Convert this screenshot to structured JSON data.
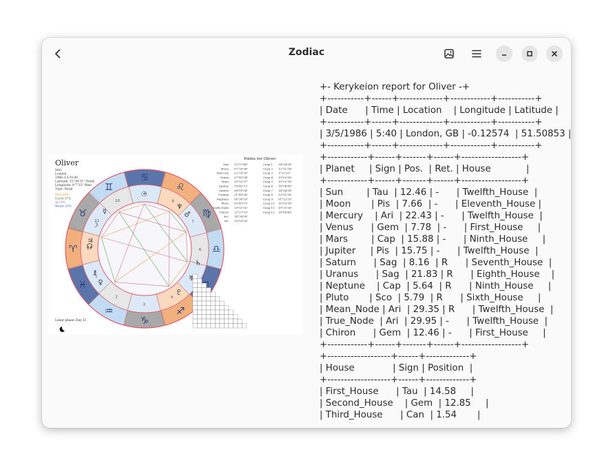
{
  "window": {
    "title": "Zodiac"
  },
  "chart": {
    "name": "Oliver",
    "info_lines": [
      "Info:",
      "London",
      "1986-3-5 05:40",
      "Latitude: 51°30'31\" North",
      "Longitude: 0°7'33\" West",
      "Type: Natal"
    ],
    "element_lines": [
      {
        "text": "Fire 23%",
        "color": "#f08a2b"
      },
      {
        "text": "Earth 47%",
        "color": "#3a8a3a"
      },
      {
        "text": "Air 9%",
        "color": "#b070c8"
      },
      {
        "text": "Water 20%",
        "color": "#3a6ad0"
      }
    ],
    "points_title": "Points for Oliver:",
    "points": [
      "Sun",
      "Moon",
      "Mercury",
      "Venus",
      "Mars",
      "Jupiter",
      "Saturn",
      "Uranus",
      "Neptune",
      "Pluto",
      "North Node",
      "Chiron",
      "Asc",
      "Mc"
    ],
    "point_values": [
      "12°27'48\"",
      "07°39'36\"",
      "22°25'35\"",
      "07°47'04\"",
      "15°52'37\"",
      "15°45'11\"",
      "08°09'54\"",
      "21°49'36\"",
      "05°38'10\"",
      "05°47'07\"",
      "29°21'02\"",
      "12°27'19\"",
      "14°34'58\"",
      "10°03'16\""
    ],
    "cusps": [
      "Cusp 1",
      "Cusp 2",
      "Cusp 3",
      "Cusp 4",
      "Cusp 5",
      "Cusp 6",
      "Cusp 7",
      "Cusp 8",
      "Cusp 9",
      "Cusp 10",
      "Cusp 11",
      "Cusp 12"
    ],
    "cusp_values": [
      "14°34'58\"",
      "12°51'18\"",
      "1°32'25\"",
      "19°03'16\"",
      "19°21'16\"",
      "18°08'49\"",
      "14°34'58\"",
      "12°51'18\"",
      "01°32'25\"",
      "10°03'16\"",
      "19°21'16\"",
      "18°08'49\""
    ],
    "lunar_phase": "Lunar phase: Day 23",
    "wheel_numbers": [
      "12",
      "11",
      "10",
      "9",
      "8",
      "7",
      "6",
      "5",
      "4",
      "3",
      "2",
      "1"
    ],
    "zodiac_glyphs": [
      "♈",
      "♉",
      "♊",
      "♋",
      "♌",
      "♍",
      "♎",
      "♏",
      "♐",
      "♑",
      "♒",
      "♓"
    ],
    "colors": {
      "fire": "#f2a46a",
      "earth": "#9a9a9a",
      "air": "#bcd8f2",
      "water": "#3d5da0",
      "ring": "#e05a6a"
    }
  },
  "report": {
    "title": "+- Kerykeion report for Oliver -+",
    "lines": [
      "+-----------+------+-------------+------------+-----------+",
      "| Date      | Time | Location    | Longitude | Latitude |",
      "+-----------+------+-------------+------------+-----------+",
      "| 3/5/1986 | 5:40 | London, GB | -0.12574  | 51.50853 |",
      "+-----------+------+-------------+------------+-----------+",
      "+------------+------+-------+------+------------------+",
      "| Planet     | Sign | Pos.  | Ret. | House            |",
      "+------------+------+-------+------+------------------+",
      "| Sun        | Tau  | 12.46 | -      | Twelfth_House  |",
      "| Moon       | Pis  | 7.66  | -      | Eleventh_House |",
      "| Mercury    | Ari  | 22.43 | -      | Twelfth_House  |",
      "| Venus      | Gem  | 7.78  | -      | First_House     |",
      "| Mars        | Cap  | 15.88 | -      | Ninth_House     |",
      "| Jupiter     | Pis  | 15.75 | -      | Twelfth_House  |",
      "| Saturn      | Sag  | 8.16  | R      | Seventh_House  |",
      "| Uranus      | Sag  | 21.83 | R      | Eighth_House    |",
      "| Neptune    | Cap  | 5.64  | R      | Ninth_House     |",
      "| Pluto       | Sco  | 5.79  | R      | Sixth_House     |",
      "| Mean_Node | Ari  | 29.35 | R      | Twelfth_House  |",
      "| True_Node  | Ari  | 29.95 | -      | Twelfth_House  |",
      "| Chiron      | Gem  | 12.46 | -      | First_House     |",
      "+------------+------+-------+------+------------------+",
      "+-------------------+------+-------------+",
      "| House             | Sign | Position  |",
      "+-------------------+------+-------------+",
      "| First_House      | Tau  | 14.58     |",
      "| Second_House    | Gem  | 12.85     |",
      "| Third_House      | Can  | 1.54       |"
    ]
  },
  "icons": {
    "back": "back-arrow-icon",
    "image": "image-icon",
    "menu": "hamburger-menu-icon",
    "minimize": "minimize-icon",
    "maximize": "maximize-icon",
    "close": "close-icon"
  }
}
